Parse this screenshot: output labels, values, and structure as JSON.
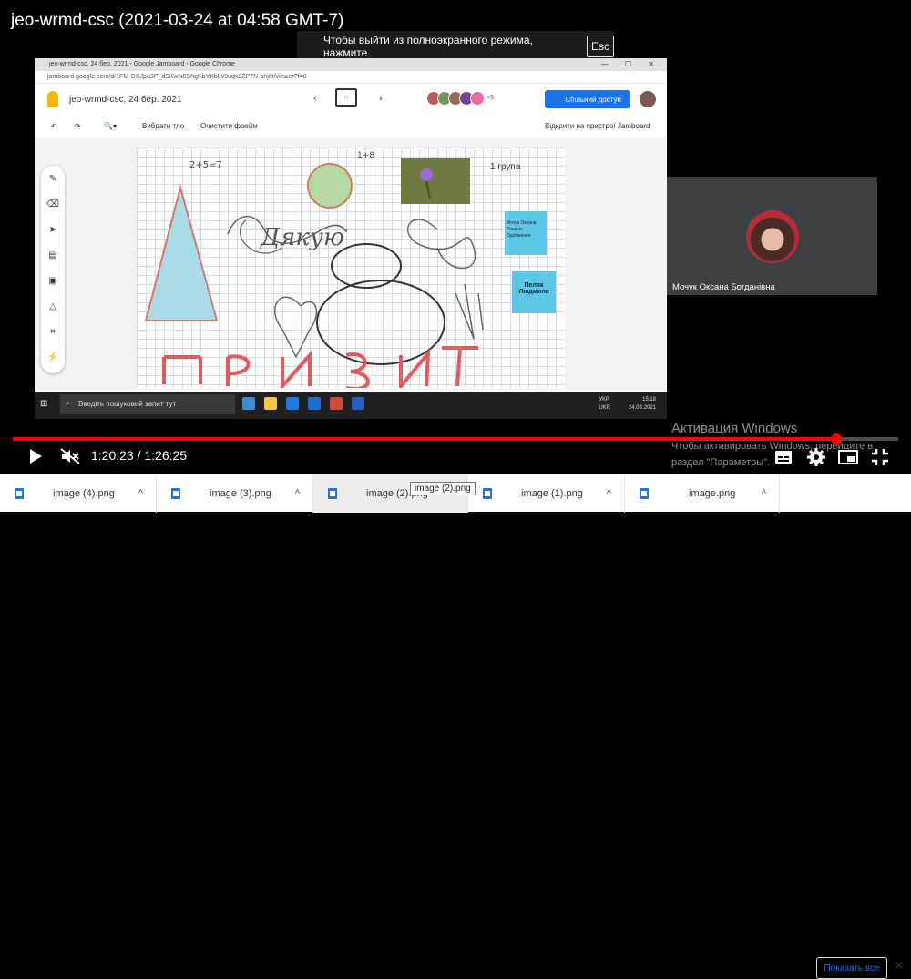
{
  "video": {
    "title": "jeo-wrmd-csc (2021-03-24 at 04:58 GMT-7)",
    "fullscreen_notice": "Чтобы выйти из полноэкранного режима, нажмите",
    "esc_key": "Esc",
    "time": "1:20:23 / 1:26:25",
    "progress_fraction": 0.93
  },
  "shared_screen": {
    "browser_title": "jeo-wrmd-csc, 24 бер. 2021 - Google Jamboard - Google Chrome",
    "url": "jamboard.google.com/d/1FM-OXJpu3P_dSKwN8ShgKbYXbLv9uqx2ZP7N-ahj0t/viewer?f=0",
    "jam_title": "jeo-wrmd-csc, 24 бер. 2021",
    "share_button": "Спільний доступ",
    "plus_count": "+5",
    "toolbar": {
      "select_background": "Вибрати тло",
      "clear_frame": "Очистити фрейм",
      "open_on_device": "Відкрити на пристрої Jamboard"
    },
    "board": {
      "equation1": "2+5=7",
      "equation2": "1+8",
      "group_label": "1 група",
      "note1": "Мочук Оксана Рощічін Одобження",
      "note2": "Пеляк Людмила",
      "scribble_word": "Дякую"
    },
    "taskbar": {
      "search_placeholder": "Введіть пошуковий запит тут",
      "lang_line1": "УКР",
      "lang_line2": "UKR",
      "clock_time": "15:18",
      "clock_date": "24.03.2021"
    }
  },
  "participant": {
    "name": "Мочук Оксана Богданівна"
  },
  "windows_activation": {
    "title": "Активация Windows",
    "line1": "Чтобы активировать Windows, перейдите в",
    "line2": "раздел \"Параметры\"."
  },
  "downloads": {
    "items": [
      "image (4).png",
      "image (3).png",
      "image (2).png",
      "image (1).png",
      "image.png"
    ],
    "tooltip": "image (2).png",
    "show_all": "Показать все"
  },
  "colors": {
    "accent_red": "#ff0000",
    "jam_blue": "#1a73e8",
    "sticky_note": "#5bc8e8"
  }
}
